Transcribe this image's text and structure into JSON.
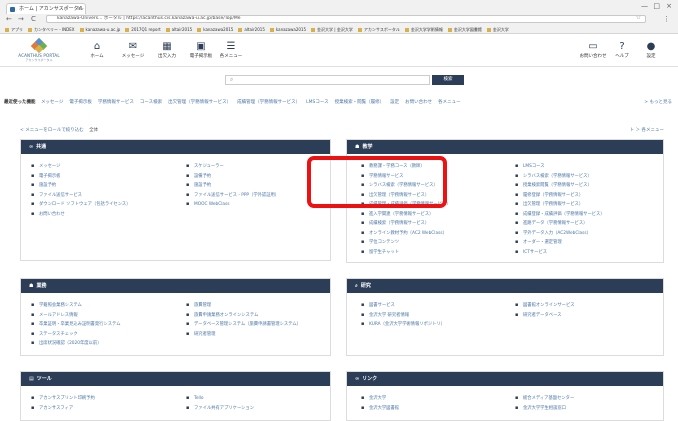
{
  "browser": {
    "tab_title": "ホーム | アカンサスポータル",
    "tab_close": "×",
    "address": "kanazawa-Univers... ポータル | https://acanthus.cis.kanazawa-u.ac.jp/base/Top/Me",
    "back": "←",
    "forward": "→",
    "reload": "C",
    "window_controls": [
      "—",
      "□",
      "×"
    ],
    "bookmarks": [
      "アプリ",
      "カンタベリー - INDEX",
      "kanazawa-u.ac.jp",
      "2017Q1 report",
      "altair2015",
      "kanazawa2015",
      "altair2015",
      "kanazawa2015",
      "金沢大学 | 金沢大学",
      "アカンサスポータル",
      "金沢大学学術情報",
      "金沢大学図書館",
      "金沢大学"
    ]
  },
  "header": {
    "logo_text": "ACANTHUS PORTAL",
    "logo_sub": "アカンサスポータル",
    "logo_colors": [
      "#5a8fc8",
      "#e07a3a",
      "#6ab04c",
      "#d9b04a"
    ],
    "nav": [
      {
        "icon": "⌂",
        "label": "ホーム"
      },
      {
        "icon": "✉",
        "label": "メッセージ"
      },
      {
        "icon": "▦",
        "label": "出欠入力"
      },
      {
        "icon": "▣",
        "label": "電子掲示板"
      },
      {
        "icon": "☰",
        "label": "各メニュー"
      }
    ],
    "right": [
      {
        "icon": "▭",
        "label": "お問い合わせ"
      },
      {
        "icon": "?",
        "label": "ヘルプ"
      },
      {
        "icon": "●",
        "label": "設定"
      }
    ]
  },
  "search": {
    "placeholder": "",
    "button": "検索",
    "icon": "⌕"
  },
  "recent": {
    "title": "最近使った機能",
    "links": [
      "メッセージ",
      "電子掲示板",
      "学務情報サービス",
      "コース検索",
      "出欠管理（学務情報サービス）",
      "成績管理（学務情報サービス）",
      "LMSコース",
      "授業検索・閲覧（履修）",
      "設定",
      "お問い合わせ",
      "各メニュー"
    ],
    "more": "> もっと見る"
  },
  "breadcrumb": {
    "home": "< メニューをロールで絞り込む",
    "current": "全体",
    "right": "ト ＞ 各メニュー"
  },
  "panels": {
    "common": {
      "title": "共通",
      "icon": "∞",
      "col1": [
        "メッセージ",
        "電子掲示板",
        "施設予約",
        "ファイル送信サービス",
        "ダウンロード ソフトウェア（包括ライセンス）",
        "お問い合わせ"
      ],
      "col2": [
        "スケジューラー",
        "設備予約",
        "施設予約",
        "ファイル送信サービス - PPP（学外認証用）",
        "MOOC WebClass"
      ]
    },
    "academic": {
      "title": "教学",
      "icon": "☗",
      "col1": [
        "教務課・学務コース（教師）",
        "学務情報サービス",
        "シラバス検索（学務情報サービス）",
        "出欠管理（学務情報サービス）",
        "成績管理・成績評価（学務情報サービス）",
        "進入学関連（学務情報サービス）",
        "成績検索（学務情報サービス）",
        "オンライン教材予約（AC2 WebClass）",
        "学位コンテンツ",
        "留学生チャット"
      ],
      "col2": [
        "LMSコース",
        "シラバス検索（学務情報サービス）",
        "授業検索閲覧（学務情報サービス）",
        "履修登録（学務情報サービス）",
        "出欠管理（学務情報サービス）",
        "成績登録・成績評価（学務情報サービス）",
        "進路データ（学務情報サービス）",
        "学外データ入力（AC2WebClass）",
        "オーダー・選定管理",
        "ICTサービス"
      ]
    },
    "business": {
      "title": "業務",
      "icon": "☗",
      "col1": [
        "学籍照会業務システム",
        "メールアドレス情報",
        "卒業証明・卒業見込み証明書発行システム",
        "ステータスチェック",
        "出席状況確認（2020年度以前）"
      ],
      "col2": [
        "旅費管理",
        "旅費申請業務オンラインシステム",
        "データベース管理システム（旅費申請書管理システム）",
        "研究者管理"
      ]
    },
    "research": {
      "title": "研究",
      "icon": "⌕",
      "col1": [
        "図書サービス",
        "金沢大学 研究者情報",
        "KURA（金沢大学学術情報リポジトリ）"
      ],
      "col2": [
        "図書館オンラインサービス",
        "研究者データベース"
      ]
    },
    "tools": {
      "title": "ツール",
      "icon": "▤",
      "col1": [
        "アカンサスプリント印刷予約",
        "アカンサスフィア"
      ],
      "col2": [
        "Tello",
        "ファイル共有アプリケーション"
      ]
    },
    "links": {
      "title": "リンク",
      "icon": "∞",
      "col1": [
        "金沢大学",
        "金沢大学図書館"
      ],
      "col2": [
        "総合メディア基盤センター",
        "金沢大学学生相談窓口"
      ]
    }
  },
  "highlight_color": "#ee1111",
  "header_color": "#2c3e57"
}
